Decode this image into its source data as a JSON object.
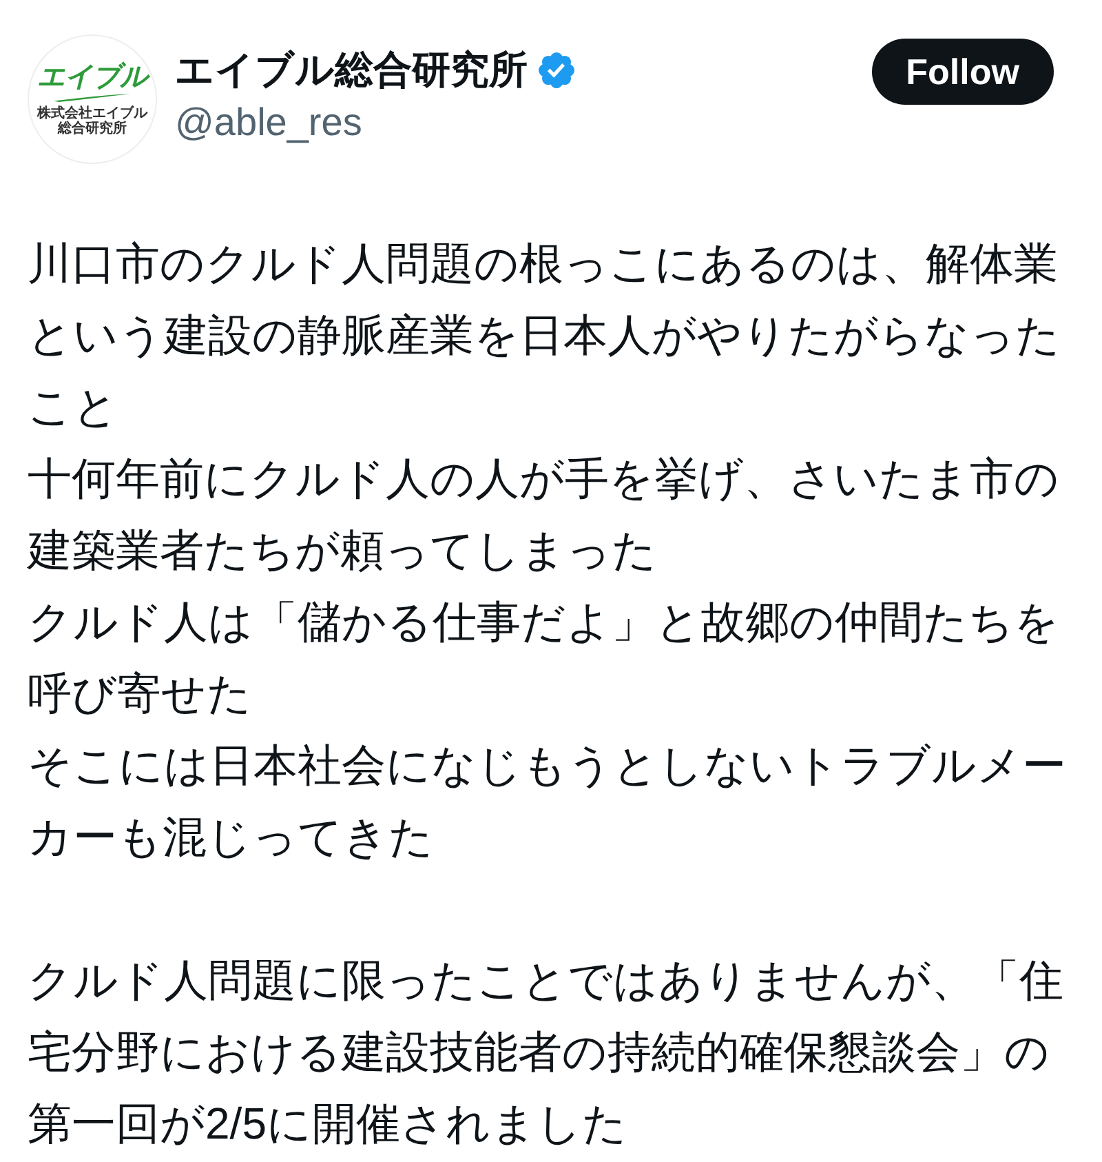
{
  "account": {
    "avatar": {
      "logo_text": "エイブル",
      "logo_subtitle": "株式会社エイブル総合研究所"
    },
    "name": "エイブル総合研究所",
    "verified": true,
    "handle": "@able_res"
  },
  "follow_button": {
    "label": "Follow"
  },
  "post": {
    "paragraphs": [
      {
        "lines": [
          "川口市のクルド人問題の根っこにあるのは、解体業という建設の静脈産業を日本人がやりたがらなったこと",
          "十何年前にクルド人の人が手を挙げ、さいたま市の建築業者たちが頼ってしまった",
          "クルド人は「儲かる仕事だよ」と故郷の仲間たちを呼び寄せた",
          "そこには日本社会になじもうとしないトラブルメーカーも混じってきた"
        ]
      },
      {
        "lines": [
          "クルド人問題に限ったことではありませんが、「住宅分野における建設技能者の持続的確保懇談会」の第一回が2/5に開催されました"
        ]
      }
    ]
  }
}
